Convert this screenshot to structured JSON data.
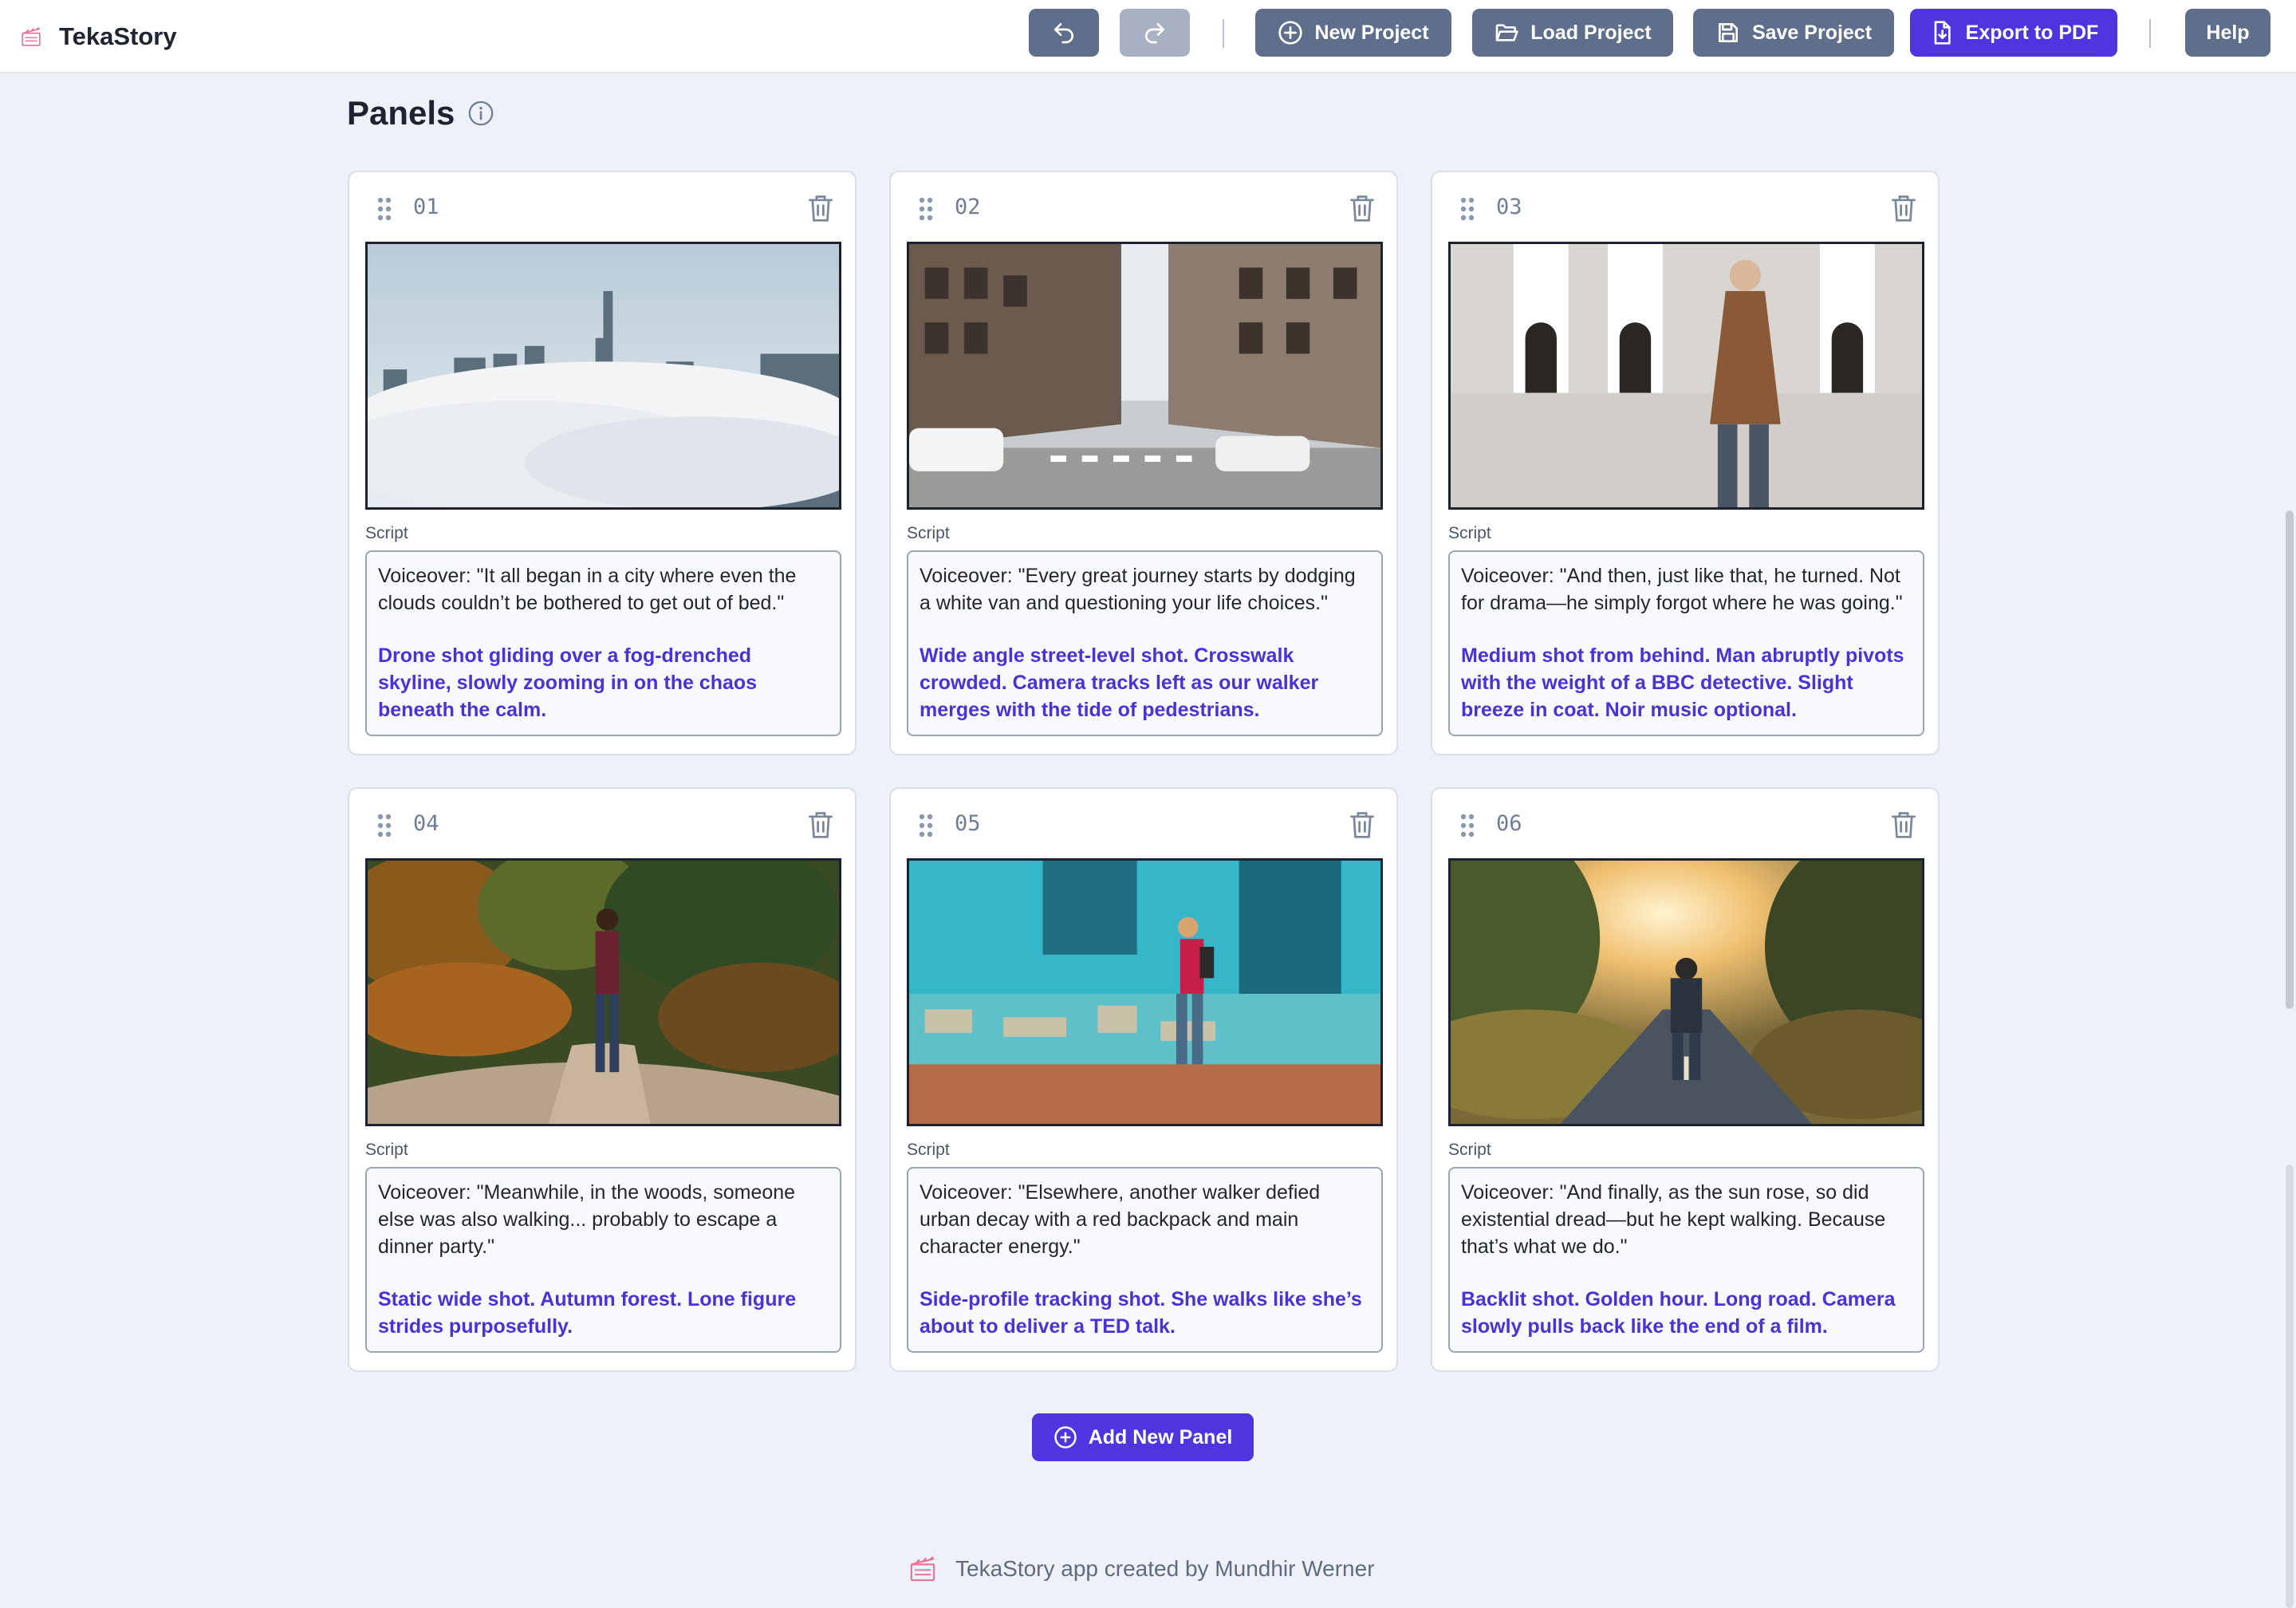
{
  "app": {
    "name": "TekaStory"
  },
  "toolbar": {
    "undo_icon": "undo-icon",
    "redo_icon": "redo-icon",
    "new_project": "New Project",
    "load_project": "Load Project",
    "save_project": "Save Project",
    "export_pdf": "Export to PDF",
    "help": "Help"
  },
  "section": {
    "title": "Panels"
  },
  "panels": [
    {
      "number": "01",
      "script_label": "Script",
      "voiceover": "Voiceover: \"It all began in a city where even the clouds couldn’t be bothered to get out of bed.\"",
      "direction": "Drone shot gliding over a fog-drenched skyline, slowly zooming in on the chaos beneath the calm."
    },
    {
      "number": "02",
      "script_label": "Script",
      "voiceover": "Voiceover: \"Every great journey starts by dodging a white van and questioning your life choices.\"",
      "direction": "Wide angle street-level shot. Crosswalk crowded. Camera tracks left as our walker merges with the tide of pedestrians."
    },
    {
      "number": "03",
      "script_label": "Script",
      "voiceover": "Voiceover: \"And then, just like that, he turned. Not for drama—he simply forgot where he was going.\"",
      "direction": "Medium shot from behind. Man abruptly pivots with the weight of a BBC detective. Slight breeze in coat. Noir music optional."
    },
    {
      "number": "04",
      "script_label": "Script",
      "voiceover": "Voiceover: \"Meanwhile, in the woods, someone else was also walking... probably to escape a dinner party.\"",
      "direction": "Static wide shot. Autumn forest. Lone figure strides purposefully."
    },
    {
      "number": "05",
      "script_label": "Script",
      "voiceover": "Voiceover: \"Elsewhere, another walker defied urban decay with a red backpack and main character energy.\"",
      "direction": "Side-profile tracking shot. She walks like she’s about to deliver a TED talk."
    },
    {
      "number": "06",
      "script_label": "Script",
      "voiceover": "Voiceover: \"And finally, as the sun rose, so did existential dread—but he kept walking. Because that’s what we do.\"",
      "direction": "Backlit shot. Golden hour. Long road. Camera slowly pulls back like the end of a film."
    }
  ],
  "add_panel": "Add New Panel",
  "footer": {
    "text": "TekaStory app created by Mundhir Werner"
  },
  "colors": {
    "primary": "#4f35e0",
    "secondary": "#5f6e8a",
    "direction_text": "#4a32d6"
  }
}
